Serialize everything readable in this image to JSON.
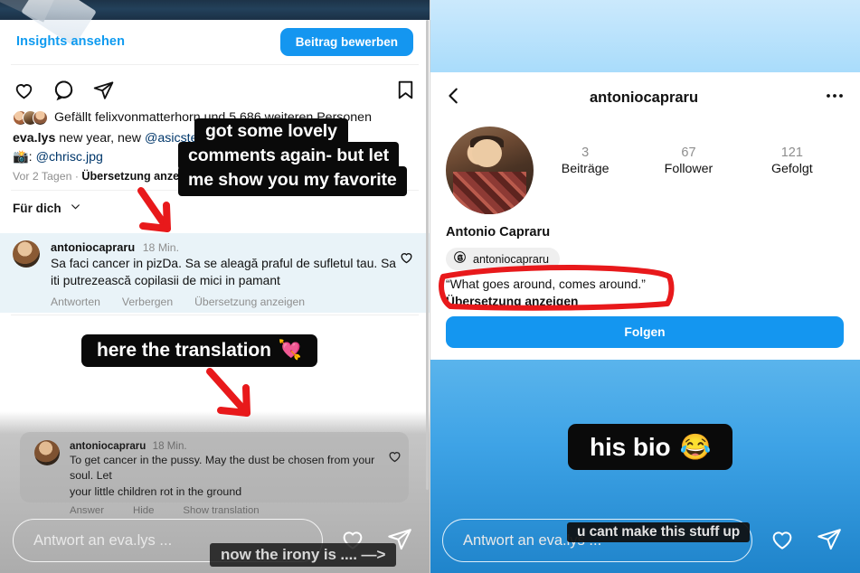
{
  "left": {
    "insights_label": "Insights ansehen",
    "promote_button": "Beitrag bewerben",
    "actions": {
      "like": "heart-icon",
      "comment": "comment-icon",
      "share": "share-icon",
      "save": "bookmark-icon"
    },
    "likes_text": "Gefällt felixvonmatterhorn und 5.686 weiteren Personen",
    "caption": {
      "username": "eva.lys",
      "text": "new year, new",
      "mention": "@asicstennis",
      "trailing": "k",
      "second_line_prefix": ": ",
      "second_line_mention": "@chrisc.jpg"
    },
    "time_ago": "Vor 2 Tagen",
    "separator": "·",
    "show_translation": "Übersetzung anzeigen",
    "filter_label": "Für dich",
    "comment_original": {
      "username": "antoniocapraru",
      "time": "18 Min.",
      "text": "Sa faci cancer in pizDa. Sa se aleagă praful de sufletul tau. Sa iti putrezească copilasii de mici in pamant",
      "actions": [
        "Antworten",
        "Verbergen",
        "Übersetzung anzeigen"
      ]
    },
    "comment_translated": {
      "username": "antoniocapraru",
      "time": "18 Min.",
      "text_line1": "To get cancer in the pussy. May the dust be chosen from your soul. Let",
      "text_line2": "your little children rot in the ground",
      "actions": [
        "Answer",
        "Hide",
        "Show translation"
      ]
    },
    "reply_placeholder": "Antwort an eva.lys ...",
    "stickers": {
      "s1": "got some lovely",
      "s2": "comments again- but let",
      "s3": "me show you my favorite",
      "translation": "here the translation",
      "translation_emoji": "💘",
      "irony": "now the irony is .... —>"
    }
  },
  "right": {
    "back_icon": "chevron-left-icon",
    "username": "antoniocapraru",
    "more_icon": "more-options-icon",
    "stats": [
      {
        "number": "3",
        "label": "Beiträge"
      },
      {
        "number": "67",
        "label": "Follower"
      },
      {
        "number": "121",
        "label": "Gefolgt"
      }
    ],
    "full_name": "Antonio Capraru",
    "threads_handle": "antoniocapraru",
    "threads_icon": "threads-icon",
    "bio_line1": "“What goes around, comes around.”",
    "bio_line2": "Übersetzung anzeigen",
    "follow_button": "Folgen",
    "reply_placeholder": "Antwort an eva.lys ...",
    "stickers": {
      "bio": "his bio",
      "bio_emoji": "😂",
      "cant": "u cant make this stuff up"
    }
  },
  "colors": {
    "instagram_blue": "#1496f0",
    "link_blue": "#0f9bf0",
    "annotation_red": "#e8191b",
    "comment_highlight": "#e9f3f8",
    "muted_gray": "#8e8e8e"
  }
}
